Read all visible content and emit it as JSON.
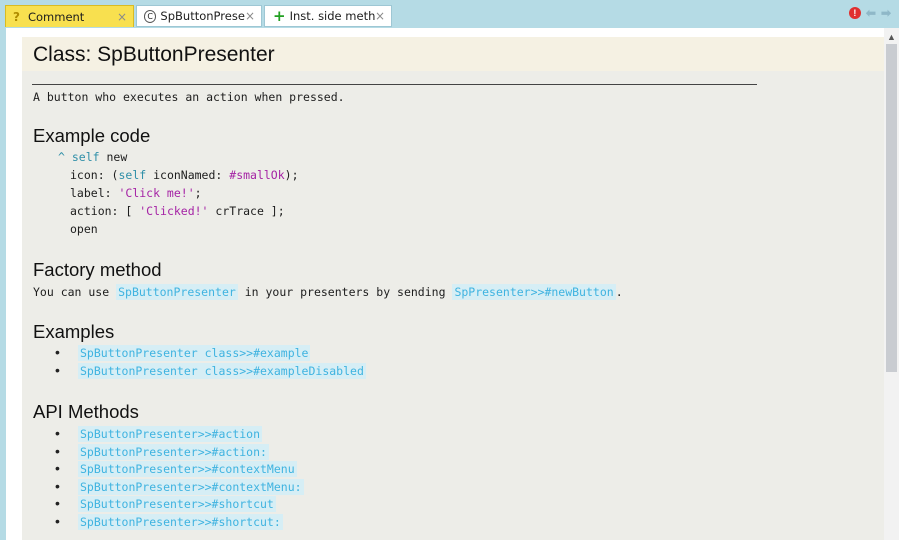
{
  "tabs": [
    {
      "label": "Comment",
      "glyph": "?",
      "close": "×"
    },
    {
      "label": "SpButtonPreser",
      "glyph": "C",
      "close": "×"
    },
    {
      "label": "Inst. side methc",
      "glyph": "+",
      "close": "×"
    }
  ],
  "toolbar_icons": [
    "alert-icon",
    "arrow-left-icon",
    "arrow-right-icon"
  ],
  "doc": {
    "title": "Class: SpButtonPresenter",
    "description": "A button who executes an action when pressed.",
    "example_heading": "Example code",
    "code": {
      "l1_caret": "^ ",
      "l1_self": "self",
      "l1_rest": " new",
      "l2_a": "icon: (",
      "l2_self": "self",
      "l2_b": " iconNamed: ",
      "l2_sym": "#smallOk",
      "l2_c": ");",
      "l3_a": "label: ",
      "l3_str": "'Click me!'",
      "l3_b": ";",
      "l4_a": "action: [ ",
      "l4_str": "'Clicked!'",
      "l4_b": " crTrace ];",
      "l5": "open"
    },
    "factory_heading": "Factory method",
    "factory": {
      "pre": "You can use ",
      "link1": "SpButtonPresenter",
      "mid": " in your presenters by sending ",
      "link2": "SpPresenter>>#newButton",
      "post": "."
    },
    "examples_heading": "Examples",
    "examples": [
      "SpButtonPresenter class>>#example",
      "SpButtonPresenter class>>#exampleDisabled"
    ],
    "api_heading": "API Methods",
    "api_methods": [
      "SpButtonPresenter>>#action",
      "SpButtonPresenter>>#action:",
      "SpButtonPresenter>>#contextMenu",
      "SpButtonPresenter>>#contextMenu:",
      "SpButtonPresenter>>#shortcut",
      "SpButtonPresenter>>#shortcut:"
    ],
    "bullet": "•"
  },
  "colors": {
    "tab_active": "#f8e04f",
    "tabbar": "#b5dbe5",
    "link": "#3fb3e0",
    "keyword": "#2f8fa8",
    "string": "#a523a5"
  }
}
